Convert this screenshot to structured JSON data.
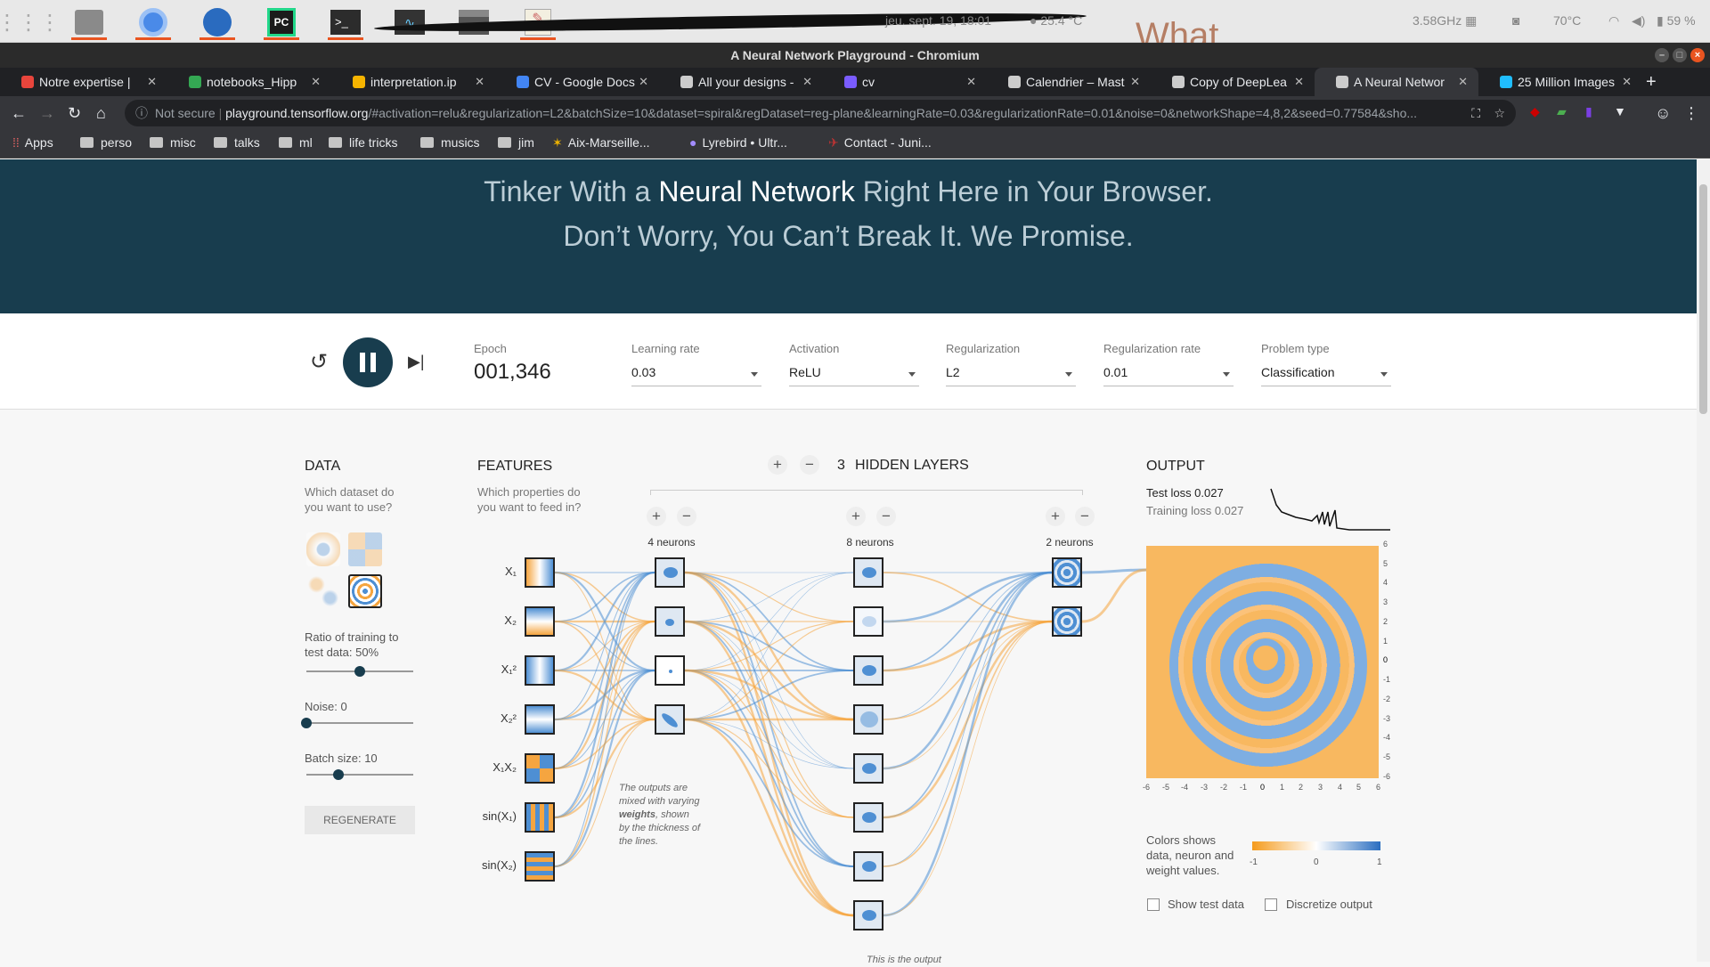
{
  "topbar": {
    "clock": "jeu. sept. 19, 18:01",
    "weather": "25.4 °C",
    "cpu": "3.58GHz",
    "temperature": "70°C",
    "battery": "59 %",
    "background_text": "What"
  },
  "window": {
    "title": "A Neural Network Playground - Chromium"
  },
  "tabs": [
    {
      "label": "Notre expertise |",
      "color": "#e8453c"
    },
    {
      "label": "notebooks_Hipp",
      "color": "#34a853"
    },
    {
      "label": "interpretation.ip",
      "color": "#f6b400"
    },
    {
      "label": "CV - Google Docs",
      "color": "#4285f4"
    },
    {
      "label": "All your designs -",
      "color": "#cccccc"
    },
    {
      "label": "cv",
      "color": "#7a5cff"
    },
    {
      "label": "Calendrier – Mast",
      "color": "#cccccc"
    },
    {
      "label": "Copy of DeepLea",
      "color": "#cccccc"
    },
    {
      "label": "A Neural Networ",
      "color": "#cccccc"
    },
    {
      "label": "25 Million Images",
      "color": "#20beff"
    }
  ],
  "omnibox": {
    "security": "Not secure",
    "host": "playground.tensorflow.org",
    "path": "/#activation=relu&regularization=L2&batchSize=10&dataset=spiral&regDataset=reg-plane&learningRate=0.03&regularizationRate=0.01&noise=0&networkShape=4,8,2&seed=0.77584&sho..."
  },
  "bookmarks": [
    "Apps",
    "perso",
    "misc",
    "talks",
    "ml",
    "life tricks",
    "musics",
    "jim",
    "Aix-Marseille...",
    "Lyrebird • Ultr...",
    "Contact - Juni..."
  ],
  "hero": {
    "line1_a": "Tinker With a ",
    "line1_b": "Neural Network",
    "line1_c": " Right Here in Your Browser.",
    "line2": "Don’t Worry, You Can’t Break It. We Promise."
  },
  "controls": {
    "epoch_label": "Epoch",
    "epoch_value": "001,346",
    "learning_rate_label": "Learning rate",
    "learning_rate": "0.03",
    "activation_label": "Activation",
    "activation": "ReLU",
    "regularization_label": "Regularization",
    "regularization": "L2",
    "reg_rate_label": "Regularization rate",
    "reg_rate": "0.01",
    "problem_label": "Problem type",
    "problem": "Classification"
  },
  "data_panel": {
    "title": "DATA",
    "subtitle_1": "Which dataset do",
    "subtitle_2": "you want to use?",
    "ratio_label_1": "Ratio of training to",
    "ratio_label_2": "test data:  50%",
    "ratio_value": 0.5,
    "noise_label": "Noise:  0",
    "noise_value": 0,
    "batch_label": "Batch size:  10",
    "batch_value": 0.3,
    "regenerate": "REGENERATE"
  },
  "features": {
    "title": "FEATURES",
    "subtitle_1": "Which properties do",
    "subtitle_2": "you want to feed in?",
    "items": [
      {
        "label": "X₁"
      },
      {
        "label": "X₂"
      },
      {
        "label": "X₁²"
      },
      {
        "label": "X₂²"
      },
      {
        "label": "X₁X₂"
      },
      {
        "label": "sin(X₁)"
      },
      {
        "label": "sin(X₂)"
      }
    ]
  },
  "network": {
    "hidden_count": "3",
    "hidden_label": "HIDDEN LAYERS",
    "layers": [
      {
        "neurons": "4 neurons"
      },
      {
        "neurons": "8 neurons"
      },
      {
        "neurons": "2 neurons"
      }
    ],
    "note_weights_1": "The outputs are",
    "note_weights_2": "mixed with varying",
    "note_weights_3b": "weights",
    "note_weights_3": ", shown",
    "note_weights_4": "by the thickness of",
    "note_weights_5": "the lines.",
    "note_output": "This is the output"
  },
  "output": {
    "title": "OUTPUT",
    "test_loss": "Test loss 0.027",
    "training_loss": "Training loss 0.027",
    "x_ticks": [
      "-6",
      "-5",
      "-4",
      "-3",
      "-2",
      "-1",
      "0",
      "1",
      "2",
      "3",
      "4",
      "5",
      "6"
    ],
    "y_ticks": [
      "6",
      "5",
      "4",
      "3",
      "2",
      "1",
      "0",
      "-1",
      "-2",
      "-3",
      "-4",
      "-5",
      "-6"
    ],
    "legend_text_1": "Colors shows",
    "legend_text_2": "data, neuron and",
    "legend_text_3": "weight values.",
    "legend_min": "-1",
    "legend_mid": "0",
    "legend_max": "1",
    "show_test": "Show test data",
    "discretize": "Discretize output"
  },
  "colors": {
    "positive": "#4e8fd3",
    "negative": "#f5a540",
    "header": "#183d4e"
  }
}
